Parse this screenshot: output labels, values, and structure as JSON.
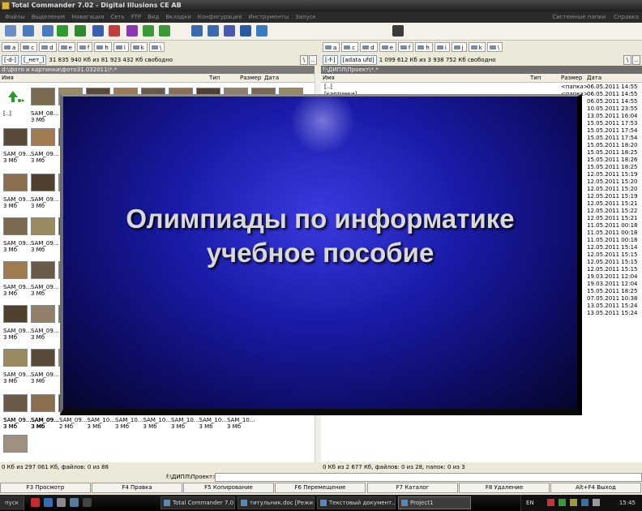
{
  "window": {
    "title": "Total Commander 7.02 - Digital Illusions CE AB"
  },
  "menu": {
    "items": [
      "Файлы",
      "Выделение",
      "Навигация",
      "Сеть",
      "FTP",
      "Вид",
      "Вкладки",
      "Конфигурация",
      "Инструменты",
      "Запуск"
    ],
    "right": [
      "Системные папки",
      "Справка"
    ]
  },
  "toolbar_icons": [
    "refresh-icon",
    "back-icon",
    "forward-icon",
    "pack-icon",
    "unpack-icon",
    "tree-icon",
    "brief-icon",
    "thumbnails-icon",
    "find-icon",
    "rename-icon",
    "sync-icon",
    "ftp-icon",
    "notepad-icon",
    "panel-icon",
    "view-icon",
    "calc-icon"
  ],
  "drives": {
    "left": [
      "a",
      "c",
      "d",
      "e",
      "f",
      "h",
      "i",
      "k",
      "\\"
    ],
    "right": [
      "a",
      "c",
      "d",
      "e",
      "f",
      "h",
      "i",
      "j",
      "k",
      "\\"
    ]
  },
  "left_panel": {
    "drive_combo": "[-d-]",
    "label_combo": "[_нет_]",
    "free": "31 835 940 Кб из 81 923 432 Кб свободно",
    "path": "d:\\фото и картинки\\фото31.032011\\*.*",
    "columns": {
      "name": "Имя",
      "type": "Тип",
      "size": "Размер",
      "date": "Дата"
    },
    "up_label": "[..]",
    "file_prefix": "SAM_09...",
    "size_3": "3 Мб",
    "size_2": "2 Мб",
    "bottom_row_names": [
      "SAM_09...",
      "SAM_09...",
      "SAM_09...",
      "SAM_10...",
      "SAM_10...",
      "SAM_10...",
      "SAM_10...",
      "SAM_10...",
      "SAM_10..."
    ],
    "bottom_row_sizes": [
      "3 Мб",
      "3 Мб",
      "2 Мб",
      "3 Мб",
      "3 Мб",
      "3 Мб",
      "3 Мб",
      "3 Мб",
      "3 Мб"
    ],
    "row_names": [
      "SAM_09...",
      "SAM_09..."
    ],
    "first_row": {
      "name1": "SAM_08...",
      "size1": "3 Мб"
    },
    "status": "0 Кб из 297 061 Кб, файлов: 0 из 88"
  },
  "right_panel": {
    "drive_combo": "[-f-]",
    "label_combo": "[adata ufd]",
    "free": "1 099 612 Кб из 3 938 752 Кб свободно",
    "path": "f:\\ДИПЛ\\Проект\\*.*",
    "columns": {
      "name": "Имя",
      "type": "Тип",
      "size": "Размер",
      "date": "Дата"
    },
    "rows": [
      {
        "name": "[..]",
        "size": "<папка>",
        "date": "06.05.2011 14:55"
      },
      {
        "name": "[картинки]",
        "size": "<папка>",
        "date": "06.05.2011 14:55"
      },
      {
        "name": "",
        "size": "",
        "date": "06.05.2011 14:55"
      },
      {
        "name": "",
        "size": "",
        "date": "10.05.2011 23:55"
      },
      {
        "name": "",
        "size": "",
        "date": "13.05.2011 16:04"
      },
      {
        "name": "",
        "size": "",
        "date": "15.05.2011 17:53"
      },
      {
        "name": "",
        "size": "",
        "date": "15.05.2011 17:54"
      },
      {
        "name": "",
        "size": "",
        "date": "15.05.2011 17:54"
      },
      {
        "name": "",
        "size": "",
        "date": "15.05.2011 18:20"
      },
      {
        "name": "",
        "size": "",
        "date": "15.05.2011 18:25"
      },
      {
        "name": "",
        "size": "",
        "date": "15.05.2011 18:26"
      },
      {
        "name": "",
        "size": "",
        "date": "15.05.2011 18:25"
      },
      {
        "name": "",
        "size": "",
        "date": "12.05.2011 15:19"
      },
      {
        "name": "",
        "size": "",
        "date": "12.05.2011 15:20"
      },
      {
        "name": "",
        "size": "",
        "date": "12.05.2011 15:20"
      },
      {
        "name": "",
        "size": "",
        "date": "12.05.2011 15:19"
      },
      {
        "name": "",
        "size": "",
        "date": "12.05.2011 15:21"
      },
      {
        "name": "",
        "size": "",
        "date": "12.05.2011 15:22"
      },
      {
        "name": "",
        "size": "",
        "date": "12.05.2011 15:21"
      },
      {
        "name": "",
        "size": "",
        "date": "11.05.2011 00:18"
      },
      {
        "name": "",
        "size": "",
        "date": "11.05.2011 00:18"
      },
      {
        "name": "",
        "size": "",
        "date": "11.05.2011 00:18"
      },
      {
        "name": "",
        "size": "",
        "date": "12.05.2011 15:14"
      },
      {
        "name": "",
        "size": "",
        "date": "12.05.2011 15:15"
      },
      {
        "name": "",
        "size": "",
        "date": "12.05.2011 15:15"
      },
      {
        "name": "",
        "size": "",
        "date": "12.05.2011 15:15"
      },
      {
        "name": "",
        "size": "",
        "date": "19.03.2011 12:04"
      },
      {
        "name": "",
        "size": "",
        "date": "19.03.2011 12:04"
      },
      {
        "name": "",
        "size": "",
        "date": "15.05.2011 18:25"
      },
      {
        "name": "",
        "size": "",
        "date": "07.05.2011 10:38"
      },
      {
        "name": "",
        "size": "",
        "date": "13.05.2011 15:24"
      },
      {
        "name": "",
        "size": "",
        "date": "13.05.2011 15:24"
      }
    ],
    "status": "0 Кб из 2 677 Кб, файлов: 0 из 28, папок: 0 из 3"
  },
  "command_line": {
    "prompt": "f:\\ДИПЛ\\Проект>"
  },
  "fkeys": [
    "F3 Просмотр",
    "F4 Правка",
    "F5 Копирование",
    "F6 Перемещение",
    "F7 Каталог",
    "F8 Удаление",
    "Alt+F4 Выход"
  ],
  "taskbar": {
    "start": "пуск",
    "items": [
      "Total Commander 7.0...",
      "титульник.doc [Режи...",
      "Текстовый документ...",
      "Project1"
    ],
    "lang": "EN",
    "clock": "15:45"
  },
  "slide": {
    "line1": "Олимпиады по информатике",
    "line2": "учебное пособие"
  },
  "colors": {
    "slide_blue": "#1a1aa8",
    "slide_dark": "#06062a",
    "title_text": "#d9d9d9"
  }
}
